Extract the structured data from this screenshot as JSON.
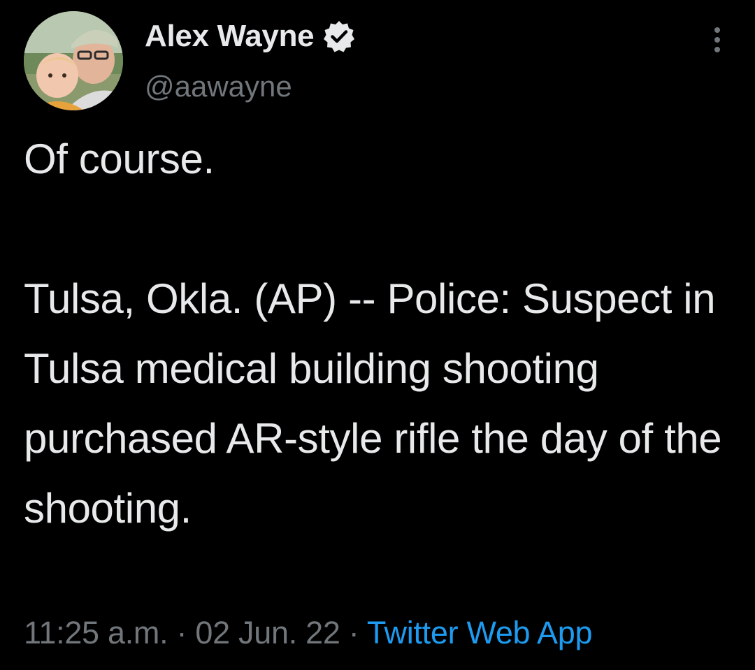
{
  "author": {
    "name": "Alex Wayne",
    "handle": "@aawayne",
    "verified": true,
    "avatar_icon": "profile-photo"
  },
  "icons": {
    "verified": "verified-badge-icon",
    "more": "more-options-icon"
  },
  "tweet": {
    "text": "Of course.\n\nTulsa, Okla. (AP) -- Police: Suspect in Tulsa medical building shooting purchased AR-style rifle the day of the shooting.",
    "time": "11:25 a.m.",
    "separator": " · ",
    "date": "02 Jun. 22",
    "source": "Twitter Web App"
  },
  "colors": {
    "background": "#000000",
    "primary_text": "#e7e9ea",
    "secondary_text": "#71767b",
    "link": "#1d9bf0"
  }
}
